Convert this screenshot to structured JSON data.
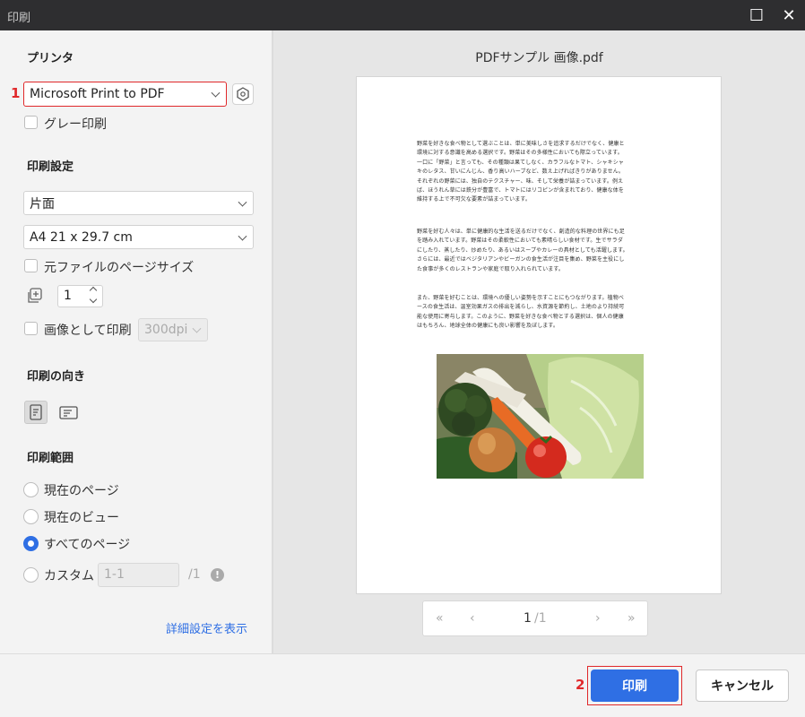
{
  "window": {
    "title": "印刷",
    "maximize_icon": "☐",
    "close_icon": "✕"
  },
  "printer": {
    "section_title": "プリンタ",
    "selected": "Microsoft Print to PDF",
    "marker": "1",
    "gray_print_label": "グレー印刷",
    "gray_print_checked": false
  },
  "print_settings": {
    "section_title": "印刷設定",
    "sides": "片面",
    "paper": "A4 21 x 29.7 cm",
    "original_size_label": "元ファイルのページサイズ",
    "original_size_checked": false,
    "copies": "1",
    "print_as_image_label": "画像として印刷",
    "print_as_image_checked": false,
    "dpi": "300dpi"
  },
  "orientation": {
    "section_title": "印刷の向き",
    "selected": "portrait"
  },
  "range": {
    "section_title": "印刷範囲",
    "options": [
      {
        "label": "現在のページ",
        "selected": false
      },
      {
        "label": "現在のビュー",
        "selected": false
      },
      {
        "label": "すべてのページ",
        "selected": true
      },
      {
        "label": "カスタム",
        "selected": false
      }
    ],
    "custom_placeholder": "1-1",
    "custom_total": "/1",
    "info_icon": "!"
  },
  "advanced_link": "詳細設定を表示",
  "preview": {
    "filename": "PDFサンプル 画像.pdf",
    "paragraphs": [
      [
        "野菜を好きな食べ物として選ぶことは、単に美味しさを追求するだけでなく、健康と",
        "環境に対する意識を高める選択です。野菜はその多様性においても際立っています。",
        "一口に「野菜」と言っても、その種類は果てしなく、カラフルなトマト、シャキシャ",
        "キのレタス、甘いにんじん、香り高いハーブなど、数え上げればきりがありません。",
        "それぞれの野菜には、独自のテクスチャー、味、そして栄養が詰まっています。例え",
        "ば、ほうれん草には鉄分が豊富で、トマトにはリコピンが含まれており、健康な体を",
        "維持する上で不可欠な要素が詰まっています。"
      ],
      [
        "野菜を好む人々は、単に健康的な生活を送るだけでなく、創造的な料理の世界にも足",
        "を踏み入れています。野菜はその柔軟性においても素晴らしい食材です。生でサラダ",
        "にしたり、蒸したり、炒めたり、あるいはスープやカレーの具材としても活躍します。",
        "さらには、最近ではベジタリアンやビーガンの食生活が注目を集め、野菜を主役にし",
        "た食事が多くのレストランや家庭で取り入れられています。"
      ],
      [
        "また、野菜を好むことは、環境への優しい姿勢を示すことにもつながります。植物ベ",
        "ースの食生活は、温室効果ガスの排出を減らし、水資源を節約し、土地のより持続可",
        "能な使用に寄与します。このように、野菜を好きな食べ物とする選択は、個人の健康",
        "はもちろん、地球全体の健康にも良い影響を及ぼします。"
      ]
    ],
    "pager": {
      "first": "«",
      "prev": "‹",
      "current": "1",
      "total": "/1",
      "next": "›",
      "last": "»"
    }
  },
  "footer": {
    "print_label": "印刷",
    "cancel_label": "キャンセル",
    "marker": "2"
  },
  "colors": {
    "accent": "#2f6fe4",
    "marker": "#e0282a",
    "titlebar": "#2e2e30"
  }
}
